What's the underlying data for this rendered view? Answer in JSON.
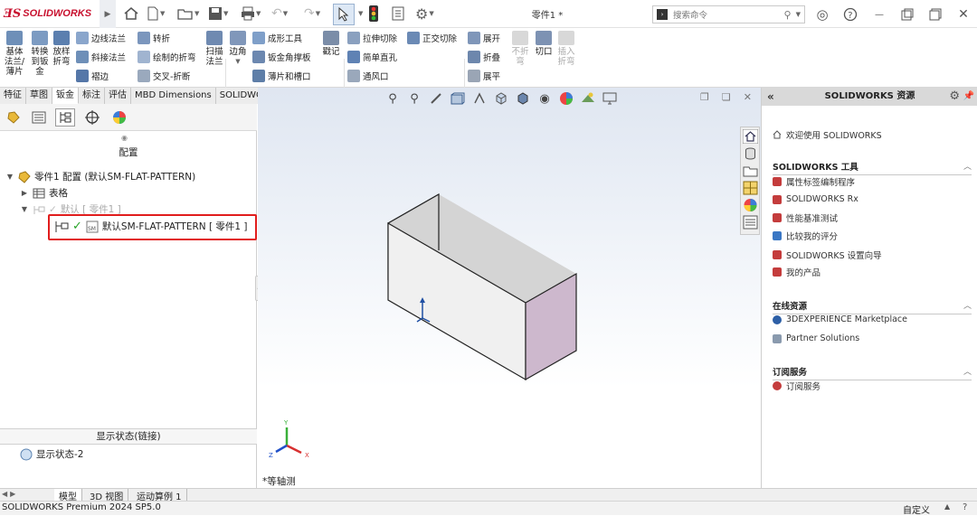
{
  "app": {
    "brand": "SOLIDWORKS",
    "doc_title": "零件1 *"
  },
  "search": {
    "placeholder": "搜索命令"
  },
  "ribbon": {
    "col1": {
      "label": "基体\n法兰/\n薄片"
    },
    "col2": {
      "label": "转换\n到钣\n金"
    },
    "col3": {
      "label": "放样\n折弯"
    },
    "row_a": [
      "边线法兰",
      "斜接法兰",
      "褶边"
    ],
    "row_b": [
      "转折",
      "绘制的折弯",
      "交叉-折断"
    ],
    "col_sweep": {
      "label": "扫描\n法兰"
    },
    "corner": {
      "label": "边角"
    },
    "row_c": [
      "成形工具",
      "钣金角撑板",
      "薄片和槽口"
    ],
    "stamp": {
      "label": "戳记"
    },
    "row_d": [
      "拉伸切除",
      "简单直孔",
      "通风口"
    ],
    "normal_cut": "正交切除",
    "row_e": [
      "展开",
      "折叠",
      "展平"
    ],
    "no_bend": {
      "label": "不折\n弯"
    },
    "cut_off": {
      "label": "切口"
    },
    "insert_bend": {
      "label": "插入\n折弯"
    }
  },
  "tabs": [
    "特征",
    "草图",
    "钣金",
    "标注",
    "评估",
    "MBD Dimensions",
    "SOLIDWORKS 插件"
  ],
  "active_tab": "钣金",
  "left_pane": {
    "header": "配置",
    "tree": [
      {
        "label": "零件1 配置  (默认SM-FLAT-PATTERN)"
      },
      {
        "label": "表格"
      },
      {
        "label": "默认 [ 零件1 ]"
      },
      {
        "label": "默认SM-FLAT-PATTERN [ 零件1 ]"
      }
    ],
    "display_state_title": "显示状态(链接)",
    "display_state_item": "显示状态-2"
  },
  "viewport": {
    "view_label": "*等轴测",
    "triad_x": "X",
    "triad_y": "Y",
    "triad_z": "Z"
  },
  "right_pane": {
    "title": "SOLIDWORKS 资源",
    "welcome": "欢迎使用 SOLIDWORKS",
    "sections": [
      {
        "title": "SOLIDWORKS 工具",
        "items": [
          "属性标签编制程序",
          "SOLIDWORKS Rx",
          "性能基准测试",
          "比较我的评分",
          "SOLIDWORKS 设置向导",
          "我的产品"
        ]
      },
      {
        "title": "在线资源",
        "items": [
          "3DEXPERIENCE Marketplace",
          "Partner Solutions"
        ]
      },
      {
        "title": "订阅服务",
        "items": [
          "订阅服务"
        ]
      }
    ]
  },
  "bottom_tabs": [
    "模型",
    "3D 视图",
    "运动算例 1"
  ],
  "status": {
    "left": "SOLIDWORKS Premium 2024 SP5.0",
    "right": "自定义"
  },
  "colors": {
    "brand_red": "#c8102e",
    "highlight_box": "#e11d1d",
    "flange_side": "#c9b5c9",
    "accent_blue": "#1f4fa3"
  }
}
